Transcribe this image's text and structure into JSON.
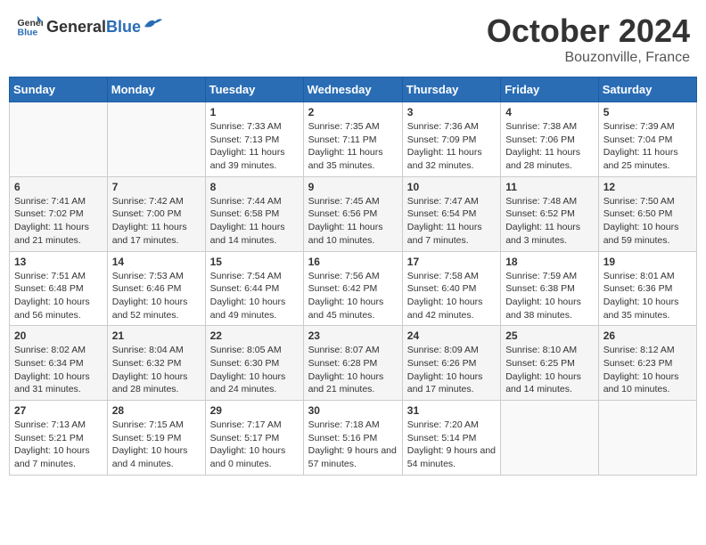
{
  "header": {
    "logo_general": "General",
    "logo_blue": "Blue",
    "month_title": "October 2024",
    "location": "Bouzonville, France"
  },
  "days_of_week": [
    "Sunday",
    "Monday",
    "Tuesday",
    "Wednesday",
    "Thursday",
    "Friday",
    "Saturday"
  ],
  "weeks": [
    [
      {
        "day": "",
        "info": ""
      },
      {
        "day": "",
        "info": ""
      },
      {
        "day": "1",
        "info": "Sunrise: 7:33 AM\nSunset: 7:13 PM\nDaylight: 11 hours and 39 minutes."
      },
      {
        "day": "2",
        "info": "Sunrise: 7:35 AM\nSunset: 7:11 PM\nDaylight: 11 hours and 35 minutes."
      },
      {
        "day": "3",
        "info": "Sunrise: 7:36 AM\nSunset: 7:09 PM\nDaylight: 11 hours and 32 minutes."
      },
      {
        "day": "4",
        "info": "Sunrise: 7:38 AM\nSunset: 7:06 PM\nDaylight: 11 hours and 28 minutes."
      },
      {
        "day": "5",
        "info": "Sunrise: 7:39 AM\nSunset: 7:04 PM\nDaylight: 11 hours and 25 minutes."
      }
    ],
    [
      {
        "day": "6",
        "info": "Sunrise: 7:41 AM\nSunset: 7:02 PM\nDaylight: 11 hours and 21 minutes."
      },
      {
        "day": "7",
        "info": "Sunrise: 7:42 AM\nSunset: 7:00 PM\nDaylight: 11 hours and 17 minutes."
      },
      {
        "day": "8",
        "info": "Sunrise: 7:44 AM\nSunset: 6:58 PM\nDaylight: 11 hours and 14 minutes."
      },
      {
        "day": "9",
        "info": "Sunrise: 7:45 AM\nSunset: 6:56 PM\nDaylight: 11 hours and 10 minutes."
      },
      {
        "day": "10",
        "info": "Sunrise: 7:47 AM\nSunset: 6:54 PM\nDaylight: 11 hours and 7 minutes."
      },
      {
        "day": "11",
        "info": "Sunrise: 7:48 AM\nSunset: 6:52 PM\nDaylight: 11 hours and 3 minutes."
      },
      {
        "day": "12",
        "info": "Sunrise: 7:50 AM\nSunset: 6:50 PM\nDaylight: 10 hours and 59 minutes."
      }
    ],
    [
      {
        "day": "13",
        "info": "Sunrise: 7:51 AM\nSunset: 6:48 PM\nDaylight: 10 hours and 56 minutes."
      },
      {
        "day": "14",
        "info": "Sunrise: 7:53 AM\nSunset: 6:46 PM\nDaylight: 10 hours and 52 minutes."
      },
      {
        "day": "15",
        "info": "Sunrise: 7:54 AM\nSunset: 6:44 PM\nDaylight: 10 hours and 49 minutes."
      },
      {
        "day": "16",
        "info": "Sunrise: 7:56 AM\nSunset: 6:42 PM\nDaylight: 10 hours and 45 minutes."
      },
      {
        "day": "17",
        "info": "Sunrise: 7:58 AM\nSunset: 6:40 PM\nDaylight: 10 hours and 42 minutes."
      },
      {
        "day": "18",
        "info": "Sunrise: 7:59 AM\nSunset: 6:38 PM\nDaylight: 10 hours and 38 minutes."
      },
      {
        "day": "19",
        "info": "Sunrise: 8:01 AM\nSunset: 6:36 PM\nDaylight: 10 hours and 35 minutes."
      }
    ],
    [
      {
        "day": "20",
        "info": "Sunrise: 8:02 AM\nSunset: 6:34 PM\nDaylight: 10 hours and 31 minutes."
      },
      {
        "day": "21",
        "info": "Sunrise: 8:04 AM\nSunset: 6:32 PM\nDaylight: 10 hours and 28 minutes."
      },
      {
        "day": "22",
        "info": "Sunrise: 8:05 AM\nSunset: 6:30 PM\nDaylight: 10 hours and 24 minutes."
      },
      {
        "day": "23",
        "info": "Sunrise: 8:07 AM\nSunset: 6:28 PM\nDaylight: 10 hours and 21 minutes."
      },
      {
        "day": "24",
        "info": "Sunrise: 8:09 AM\nSunset: 6:26 PM\nDaylight: 10 hours and 17 minutes."
      },
      {
        "day": "25",
        "info": "Sunrise: 8:10 AM\nSunset: 6:25 PM\nDaylight: 10 hours and 14 minutes."
      },
      {
        "day": "26",
        "info": "Sunrise: 8:12 AM\nSunset: 6:23 PM\nDaylight: 10 hours and 10 minutes."
      }
    ],
    [
      {
        "day": "27",
        "info": "Sunrise: 7:13 AM\nSunset: 5:21 PM\nDaylight: 10 hours and 7 minutes."
      },
      {
        "day": "28",
        "info": "Sunrise: 7:15 AM\nSunset: 5:19 PM\nDaylight: 10 hours and 4 minutes."
      },
      {
        "day": "29",
        "info": "Sunrise: 7:17 AM\nSunset: 5:17 PM\nDaylight: 10 hours and 0 minutes."
      },
      {
        "day": "30",
        "info": "Sunrise: 7:18 AM\nSunset: 5:16 PM\nDaylight: 9 hours and 57 minutes."
      },
      {
        "day": "31",
        "info": "Sunrise: 7:20 AM\nSunset: 5:14 PM\nDaylight: 9 hours and 54 minutes."
      },
      {
        "day": "",
        "info": ""
      },
      {
        "day": "",
        "info": ""
      }
    ]
  ]
}
